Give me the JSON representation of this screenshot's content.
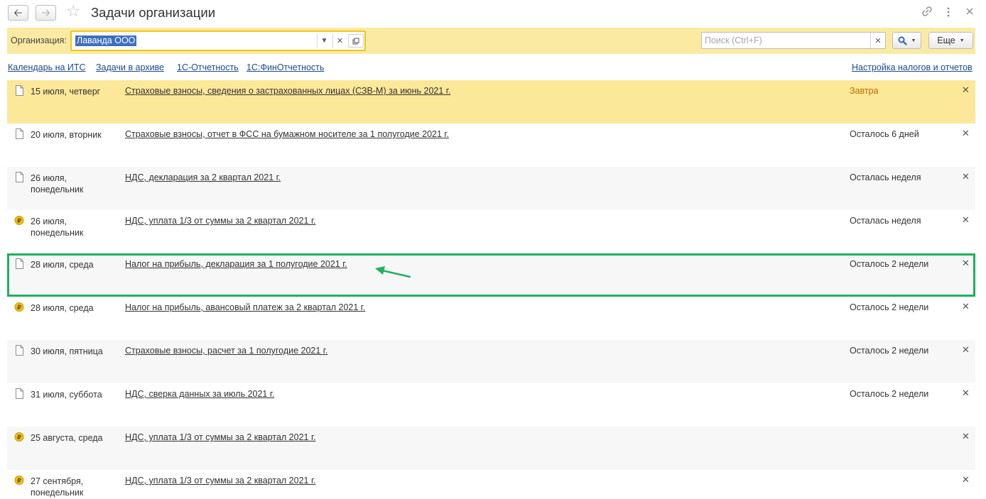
{
  "window": {
    "title": "Задачи организации",
    "icons": [
      "back-arrow-icon",
      "forward-arrow-icon",
      "star-icon",
      "link-icon",
      "more-vertical-icon",
      "close-icon"
    ]
  },
  "filter": {
    "organization_label": "Организация:",
    "organization_value": "Лаванда ООО",
    "search_placeholder": "Поиск (Ctrl+F)",
    "more_label": "Еще"
  },
  "links": {
    "calendar": "Календарь на ИТС",
    "archive": "Задачи в архиве",
    "reporting": "1С-Отчетность",
    "fin_reporting": "1С:ФинОтчетность",
    "tax_settings": "Настройка налогов и отчетов"
  },
  "colors": {
    "accent_yellow": "#fbeba2",
    "current_row": "#fce899",
    "link": "#1a4a8c",
    "highlight": "#1eb15f",
    "ruble_coin": "#f2c200"
  },
  "tasks": [
    {
      "icon": "document-icon",
      "date": "15 июля, четверг",
      "title": "Страховые взносы, сведения о застрахованных лицах (СЗВ-М) за июнь 2021 г.",
      "status": "Завтра"
    },
    {
      "icon": "document-icon",
      "date": "20 июля, вторник",
      "title": "Страховые взносы, отчет в ФСС на бумажном носителе за 1 полугодие 2021 г.",
      "status": "Осталось 6 дней"
    },
    {
      "icon": "document-icon",
      "date": "26 июля, понедельник",
      "title": "НДС, декларация за 2 квартал 2021 г.",
      "status": "Осталась неделя"
    },
    {
      "icon": "ruble-coin-icon",
      "date": "26 июля, понедельник",
      "title": "НДС, уплата 1/3 от суммы за 2 квартал 2021 г.",
      "status": "Осталась неделя"
    },
    {
      "icon": "document-icon",
      "date": "28 июля, среда",
      "title": "Налог на прибыль, декларация за 1 полугодие 2021 г.",
      "status": "Осталось 2 недели"
    },
    {
      "icon": "ruble-coin-icon",
      "date": "28 июля, среда",
      "title": "Налог на прибыль, авансовый платеж за 2 квартал 2021 г.",
      "status": "Осталось 2 недели"
    },
    {
      "icon": "document-icon",
      "date": "30 июля, пятница",
      "title": "Страховые взносы, расчет за 1 полугодие 2021 г.",
      "status": "Осталось 2 недели"
    },
    {
      "icon": "document-icon",
      "date": "31 июля, суббота",
      "title": "НДС, сверка данных за июль 2021 г.",
      "status": "Осталось 2 недели"
    },
    {
      "icon": "ruble-coin-icon",
      "date": "25 августа, среда",
      "title": "НДС, уплата 1/3 от суммы за 2 квартал 2021 г.",
      "status": ""
    },
    {
      "icon": "ruble-coin-icon",
      "date": "27 сентября, понедельник",
      "title": "НДС, уплата 1/3 от суммы за 2 квартал 2021 г.",
      "status": ""
    }
  ]
}
